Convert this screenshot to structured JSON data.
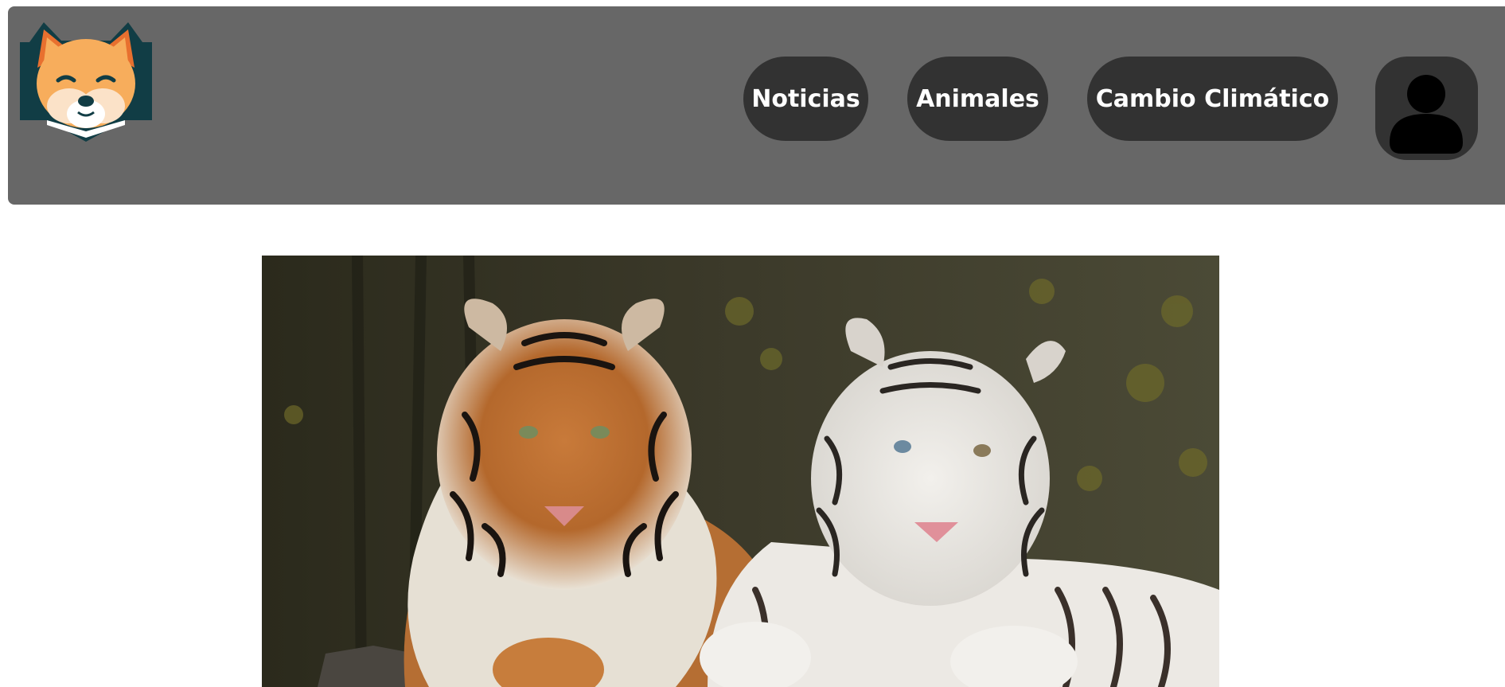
{
  "header": {
    "logo_icon": "fox-head-logo-icon",
    "nav": [
      {
        "label": "Noticias"
      },
      {
        "label": "Animales"
      },
      {
        "label": "Cambio Climático"
      }
    ],
    "profile_icon": "user-icon"
  },
  "hero": {
    "image": "two-tigers-orange-and-white"
  },
  "colors": {
    "header_bg": "#676767",
    "button_bg": "#323232",
    "button_text": "#ffffff",
    "logo_dark": "#113d45",
    "logo_orange": "#f7ad5c",
    "logo_ear": "#e8702f"
  }
}
